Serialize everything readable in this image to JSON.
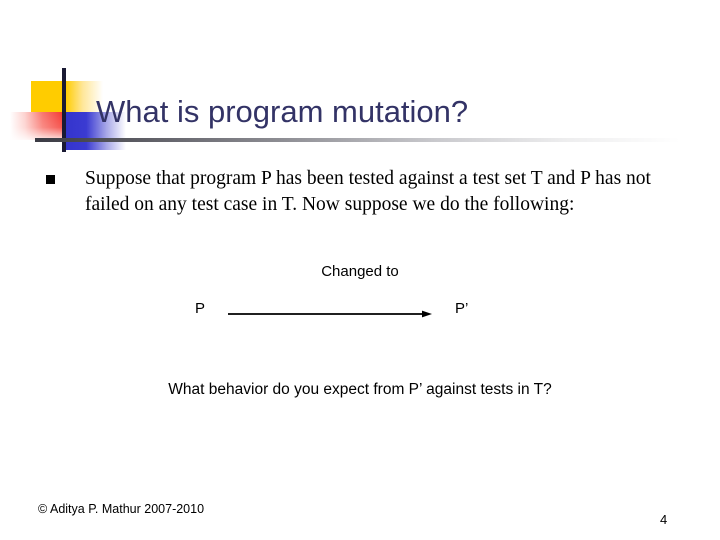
{
  "slide": {
    "title": "What is program mutation?",
    "page_number": "4",
    "footer_credit": "© Aditya P. Mathur 2007-2010"
  },
  "body": {
    "bullet_glyph": "square-bullet",
    "bullet_text": "Suppose that program P has been tested against a test set T and P has not failed on any test case in T. Now suppose we do the following:"
  },
  "diagram": {
    "arrow_label": "Changed to",
    "source_node": "P",
    "target_node": "P’",
    "arrow_icon": "right-arrow-icon"
  },
  "question": {
    "text": "What behavior do you expect from P’ against tests in T?"
  },
  "colors": {
    "title": "#333366",
    "accent_yellow": "#FFCC00",
    "accent_red": "#F43A33",
    "accent_blue": "#3333CC",
    "rule_dark": "#1a1a33",
    "body_text": "#000000",
    "background": "#FFFFFF"
  }
}
